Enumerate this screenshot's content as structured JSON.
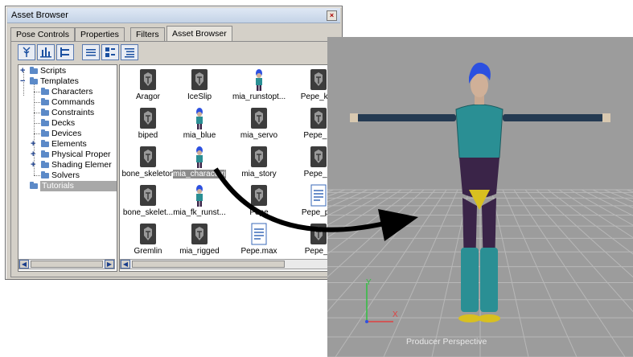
{
  "window": {
    "title": "Asset Browser",
    "tabs": [
      "Pose Controls",
      "Properties",
      "Filters",
      "Asset Browser"
    ],
    "active_tab": "Asset Browser"
  },
  "toolbar": {
    "buttons": [
      "tree-view-icon",
      "bar-view-icon",
      "hierarchy-icon",
      "list-icon",
      "thumbnail-icon",
      "details-icon"
    ]
  },
  "tree": {
    "items": [
      {
        "label": "Scripts"
      },
      {
        "label": "Templates"
      },
      {
        "label": "Characters"
      },
      {
        "label": "Commands"
      },
      {
        "label": "Constraints"
      },
      {
        "label": "Decks"
      },
      {
        "label": "Devices"
      },
      {
        "label": "Elements"
      },
      {
        "label": "Physical Proper"
      },
      {
        "label": "Shading Elemer"
      },
      {
        "label": "Solvers"
      },
      {
        "label": "Tutorials",
        "selected": true
      }
    ]
  },
  "assets": [
    {
      "label": "Aragor",
      "icon": "template-icon"
    },
    {
      "label": "IceSlip",
      "icon": "template-icon"
    },
    {
      "label": "mia_runstopt...",
      "icon": "character-thumbnail"
    },
    {
      "label": "Pepe_key",
      "icon": "template-icon"
    },
    {
      "label": "biped",
      "icon": "template-icon"
    },
    {
      "label": "mia_blue",
      "icon": "character-thumbnail"
    },
    {
      "label": "mia_servo",
      "icon": "template-icon"
    },
    {
      "label": "Pepe_M",
      "icon": "template-icon"
    },
    {
      "label": "bone_skeleton",
      "icon": "template-icon"
    },
    {
      "label": "mia_characterized",
      "icon": "character-thumbnail",
      "selected": true
    },
    {
      "label": "mia_story",
      "icon": "template-icon"
    },
    {
      "label": "Pepe_pl",
      "icon": "template-icon"
    },
    {
      "label": "bone_skelet...",
      "icon": "template-icon"
    },
    {
      "label": "mia_fk_runst...",
      "icon": "character-thumbnail"
    },
    {
      "label": "Pepe",
      "icon": "template-icon"
    },
    {
      "label": "Pepe_plo",
      "icon": "document-icon"
    },
    {
      "label": "Gremlin",
      "icon": "template-icon"
    },
    {
      "label": "mia_rigged",
      "icon": "template-icon"
    },
    {
      "label": "Pepe.max",
      "icon": "document-icon"
    },
    {
      "label": "Pepe_ri",
      "icon": "template-icon"
    }
  ],
  "viewport": {
    "label": "Producer Perspective",
    "axis_x": "X",
    "axis_y": "Y"
  },
  "colors": {
    "viewport_bg": "#9c9c9c",
    "character_teal": "#2a8f94",
    "character_purple": "#3a2448",
    "hair_blue": "#2c50e0"
  }
}
